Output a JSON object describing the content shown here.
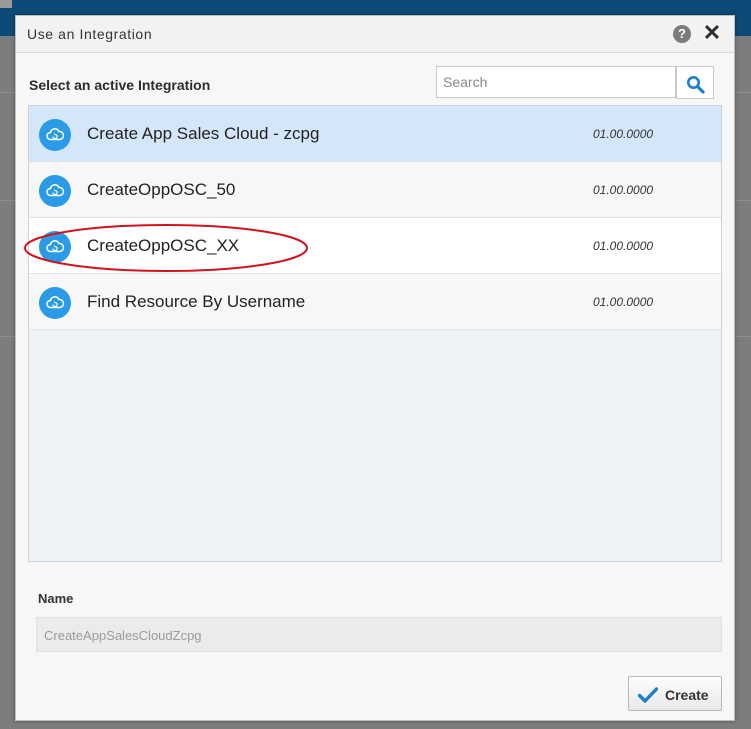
{
  "dialog": {
    "title": "Use an Integration",
    "help_icon": "help-icon",
    "close_icon": "close-icon"
  },
  "list": {
    "heading": "Select an active Integration",
    "search": {
      "placeholder": "Search",
      "value": ""
    },
    "items": [
      {
        "name": "Create App Sales Cloud - zcpg",
        "version": "01.00.0000",
        "icon": "cloud-refresh-icon",
        "selected": true
      },
      {
        "name": "CreateOppOSC_50",
        "version": "01.00.0000",
        "icon": "cloud-refresh-icon",
        "selected": false
      },
      {
        "name": "CreateOppOSC_XX",
        "version": "01.00.0000",
        "icon": "cloud-refresh-icon",
        "selected": false,
        "highlighted": true
      },
      {
        "name": "Find Resource By Username",
        "version": "01.00.0000",
        "icon": "cloud-refresh-icon",
        "selected": false
      }
    ]
  },
  "name_field": {
    "label": "Name",
    "value": "CreateAppSalesCloudZcpg"
  },
  "footer": {
    "create_label": "Create"
  },
  "colors": {
    "accent": "#2b9be7",
    "selected_row": "#d4e6fa",
    "annotation": "#d0141b",
    "header_bar": "#0c4a78"
  }
}
